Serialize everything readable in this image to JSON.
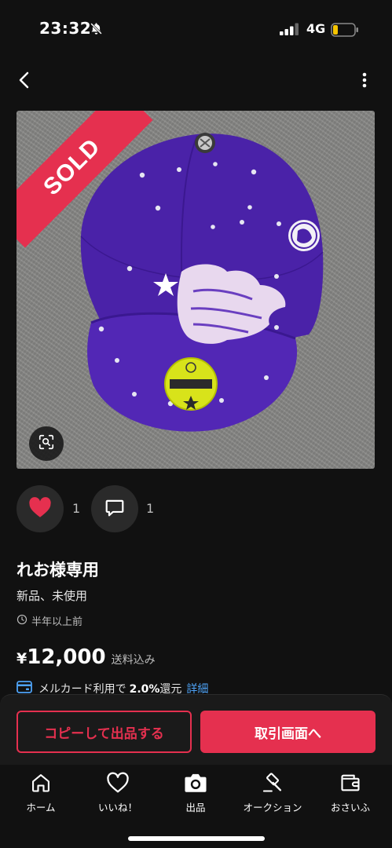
{
  "status_bar": {
    "time": "23:32",
    "network": "4G",
    "icons": [
      "bell-off-icon",
      "signal-icon",
      "battery-icon"
    ],
    "battery_color": "#f5c400"
  },
  "nav": {
    "back_icon": "chevron-left-icon",
    "more_icon": "more-vertical-icon"
  },
  "photo": {
    "badge": "SOLD",
    "badge_color": "#e5304f",
    "scan_icon": "image-search-icon"
  },
  "reactions": {
    "likes": "1",
    "comments": "1"
  },
  "item": {
    "title": "れお様専用",
    "condition": "新品、未使用",
    "posted": "半年以上前"
  },
  "price": {
    "currency": "¥",
    "amount": "12,000",
    "note": "送料込み"
  },
  "card_promo": {
    "text": "メルカード利用で",
    "rate": "2.0%",
    "unit": "還元",
    "link": "詳細"
  },
  "actions": {
    "copy_label": "コピーして出品する",
    "trade_label": "取引画面へ"
  },
  "tabs": [
    {
      "label": "ホーム",
      "icon": "home-icon"
    },
    {
      "label": "いいね！",
      "icon": "heart-outline-icon"
    },
    {
      "label": "出品",
      "icon": "camera-icon"
    },
    {
      "label": "オークション",
      "icon": "gavel-icon"
    },
    {
      "label": "おさいふ",
      "icon": "wallet-icon"
    }
  ],
  "colors": {
    "accent": "#e5304f",
    "background": "#111111",
    "link": "#4ea3f7"
  }
}
